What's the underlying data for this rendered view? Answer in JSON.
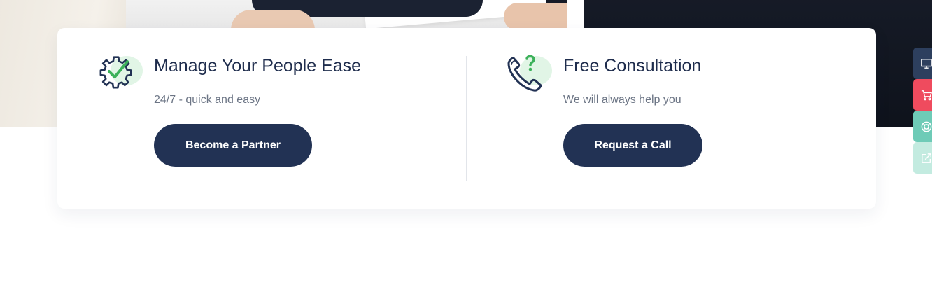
{
  "features": [
    {
      "title": "Manage Your People Ease",
      "subtitle": "24/7 - quick and easy",
      "button_label": "Become a Partner",
      "icon": "gear-check-icon"
    },
    {
      "title": "Free Consultation",
      "subtitle": "We will always help you",
      "button_label": "Request a Call",
      "icon": "phone-question-icon"
    }
  ],
  "sidebar": {
    "items": [
      {
        "icon": "monitor-icon",
        "color": "#2d3f5e"
      },
      {
        "icon": "cart-icon",
        "color": "#ef4b5e"
      },
      {
        "icon": "lifebuoy-icon",
        "color": "#6ecbb7"
      },
      {
        "icon": "external-link-icon",
        "color": "#c3ebe0"
      }
    ]
  },
  "colors": {
    "primary_navy": "#223254",
    "accent_green": "#3cb15a",
    "icon_blob": "#e1f5e6",
    "title_text": "#1f2d4d",
    "subtitle_text": "#6c7585"
  }
}
